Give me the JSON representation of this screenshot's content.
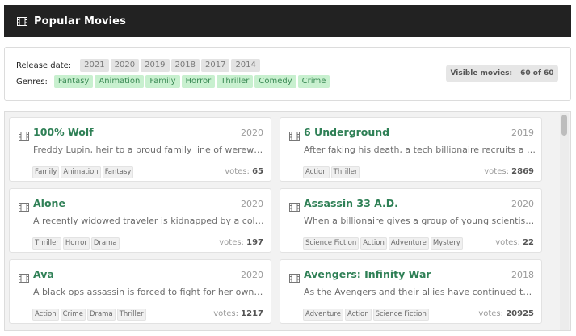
{
  "header": {
    "title": "Popular Movies",
    "icon": "film-icon"
  },
  "filters": {
    "release_label": "Release date:",
    "years": [
      "2021",
      "2020",
      "2019",
      "2018",
      "2017",
      "2014"
    ],
    "genres_label": "Genres:",
    "genres": [
      "Fantasy",
      "Animation",
      "Family",
      "Horror",
      "Thriller",
      "Comedy",
      "Crime"
    ],
    "visible_label": "Visible movies:",
    "visible_value": "60 of 60"
  },
  "movies": [
    {
      "title": "100% Wolf",
      "year": "2020",
      "description": "Freddy Lupin, heir to a proud family line of werewolves, is in for a shock when",
      "tags": [
        "Family",
        "Animation",
        "Fantasy"
      ],
      "votes_label": "votes:",
      "votes": "65"
    },
    {
      "title": "6 Underground",
      "year": "2019",
      "description": "After faking his death, a tech billionaire recruits a team of international",
      "tags": [
        "Action",
        "Thriller"
      ],
      "votes_label": "votes:",
      "votes": "2869"
    },
    {
      "title": "Alone",
      "year": "2020",
      "description": "A recently widowed traveler is kidnapped by a cold blooded killer",
      "tags": [
        "Thriller",
        "Horror",
        "Drama"
      ],
      "votes_label": "votes:",
      "votes": "197"
    },
    {
      "title": "Assassin 33 A.D.",
      "year": "2020",
      "description": "When a billionaire gives a group of young scientists unlimited funding",
      "tags": [
        "Science Fiction",
        "Action",
        "Adventure",
        "Mystery"
      ],
      "votes_label": "votes:",
      "votes": "22"
    },
    {
      "title": "Ava",
      "year": "2020",
      "description": "A black ops assassin is forced to fight for her own survival after a job",
      "tags": [
        "Action",
        "Crime",
        "Drama",
        "Thriller"
      ],
      "votes_label": "votes:",
      "votes": "1217"
    },
    {
      "title": "Avengers: Infinity War",
      "year": "2018",
      "description": "As the Avengers and their allies have continued to protect the world",
      "tags": [
        "Adventure",
        "Action",
        "Science Fiction"
      ],
      "votes_label": "votes:",
      "votes": "20925"
    }
  ],
  "colors": {
    "header_bg": "#222222",
    "accent_green": "#2f8056",
    "genre_chip_bg": "#c8f0cf",
    "year_chip_bg": "#e3e3e3"
  }
}
